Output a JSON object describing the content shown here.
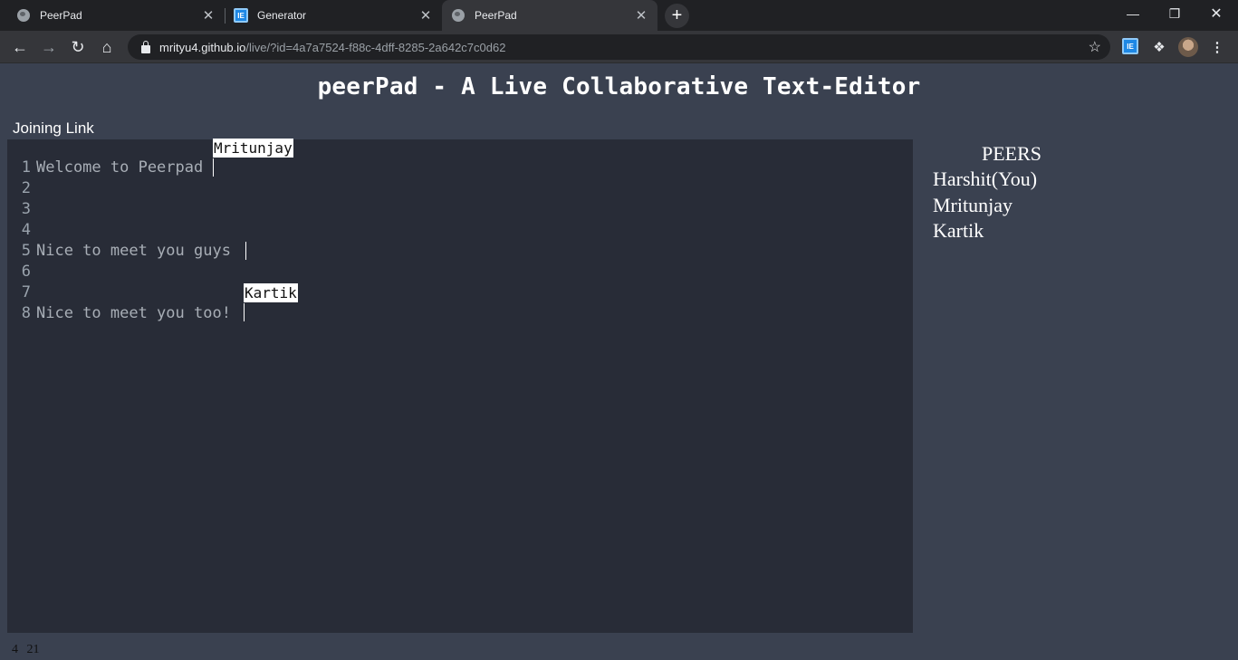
{
  "browser": {
    "tabs": [
      {
        "title": "PeerPad",
        "icon": "globe-icon"
      },
      {
        "title": "Generator",
        "icon": "ideogram-icon"
      },
      {
        "title": "PeerPad",
        "icon": "globe-icon"
      }
    ],
    "url_host": "mrityu4.github.io",
    "url_path": "/live/?id=4a7a7524-f88c-4dff-8285-2a642c7c0d62",
    "new_tab_label": "+"
  },
  "page": {
    "title": "peerPad - A Live Collaborative Text-Editor",
    "joining_link_label": "Joining Link",
    "editor": {
      "lines": [
        {
          "num": "1",
          "text": "Welcome to Peerpad"
        },
        {
          "num": "2",
          "text": ""
        },
        {
          "num": "3",
          "text": ""
        },
        {
          "num": "4",
          "text": ""
        },
        {
          "num": "5",
          "text": "Nice to meet you guys"
        },
        {
          "num": "6",
          "text": ""
        },
        {
          "num": "7",
          "text": ""
        },
        {
          "num": "8",
          "text": "Nice to meet you too!"
        }
      ],
      "remote_cursors": [
        {
          "name": "Mritunjay",
          "line": 1
        },
        {
          "name": "Kartik",
          "line": 8
        }
      ]
    },
    "peers": {
      "title": "PEERS",
      "list": [
        "Harshit(You)",
        "Mritunjay",
        "Kartik"
      ]
    },
    "status": {
      "line": "4",
      "column": "21"
    }
  },
  "colors": {
    "page_bg": "#3a4150",
    "editor_bg": "#282c37",
    "text_muted": "#a8aeb6"
  }
}
